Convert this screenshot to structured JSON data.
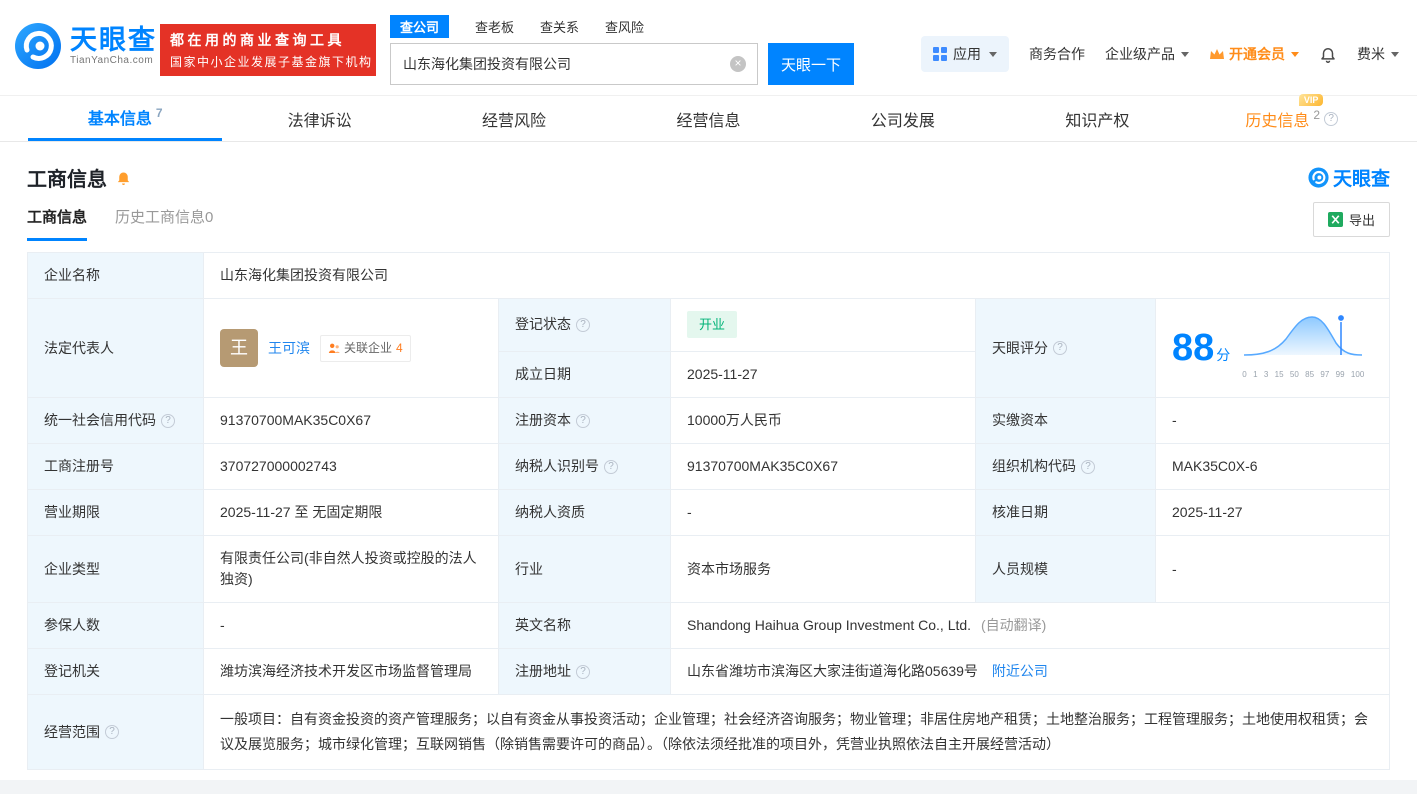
{
  "colors": {
    "accent": "#0084ff",
    "banner_red": "#e43226",
    "vip_orange": "#ff8c19",
    "status_green": "#00b377"
  },
  "header": {
    "logo": {
      "cn": "天眼查",
      "en": "TianYanCha.com"
    },
    "banner": {
      "line1": "都在用的商业查询工具",
      "line2": "国家中小企业发展子基金旗下机构"
    },
    "search": {
      "tabs": [
        {
          "label": "查公司"
        },
        {
          "label": "查老板"
        },
        {
          "label": "查关系"
        },
        {
          "label": "查风险"
        }
      ],
      "value": "山东海化集团投资有限公司",
      "button": "天眼一下"
    },
    "menu": {
      "apps": "应用",
      "cooperation": "商务合作",
      "enterprise": "企业级产品",
      "vip": "开通会员",
      "user": "费米"
    }
  },
  "nav": {
    "tabs": [
      {
        "label": "基本信息",
        "count": "7"
      },
      {
        "label": "法律诉讼"
      },
      {
        "label": "经营风险"
      },
      {
        "label": "经营信息"
      },
      {
        "label": "公司发展"
      },
      {
        "label": "知识产权"
      },
      {
        "label": "历史信息",
        "count": "2",
        "vip_tag": "VIP"
      }
    ]
  },
  "section": {
    "title": "工商信息",
    "watermark": "天眼查",
    "subtabs": [
      {
        "label": "工商信息"
      },
      {
        "label": "历史工商信息",
        "count": "0"
      }
    ],
    "export_label": "导出"
  },
  "table": {
    "company_name_label": "企业名称",
    "company_name": "山东海化集团投资有限公司",
    "legal_rep_label": "法定代表人",
    "legal_rep_avatar": "王",
    "legal_rep_name": "王可滨",
    "related_companies_label": "关联企业",
    "related_companies_count": "4",
    "reg_status_label": "登记状态",
    "reg_status": "开业",
    "est_date_label": "成立日期",
    "est_date": "2025-11-27",
    "score_label": "天眼评分",
    "score": "88",
    "score_unit": "分",
    "score_axis": [
      "0",
      "1",
      "3",
      "15",
      "50",
      "85",
      "97",
      "99",
      "100"
    ],
    "credit_code_label": "统一社会信用代码",
    "credit_code": "91370700MAK35C0X67",
    "reg_capital_label": "注册资本",
    "reg_capital": "10000万人民币",
    "paid_capital_label": "实缴资本",
    "paid_capital": "-",
    "reg_number_label": "工商注册号",
    "reg_number": "370727000002743",
    "taxpayer_id_label": "纳税人识别号",
    "taxpayer_id": "91370700MAK35C0X67",
    "org_code_label": "组织机构代码",
    "org_code": "MAK35C0X-6",
    "business_term_label": "营业期限",
    "business_term": "2025-11-27 至 无固定期限",
    "taxpayer_quality_label": "纳税人资质",
    "taxpayer_quality": "-",
    "approval_date_label": "核准日期",
    "approval_date": "2025-11-27",
    "company_type_label": "企业类型",
    "company_type": "有限责任公司(非自然人投资或控股的法人独资)",
    "industry_label": "行业",
    "industry": "资本市场服务",
    "staff_size_label": "人员规模",
    "staff_size": "-",
    "insured_label": "参保人数",
    "insured": "-",
    "english_name_label": "英文名称",
    "english_name": "Shandong Haihua Group Investment Co., Ltd.",
    "english_name_note": "(自动翻译)",
    "reg_authority_label": "登记机关",
    "reg_authority": "潍坊滨海经济技术开发区市场监督管理局",
    "address_label": "注册地址",
    "address": "山东省潍坊市滨海区大家洼街道海化路05639号",
    "nearby_link": "附近公司",
    "scope_label": "经营范围",
    "scope": "一般项目：自有资金投资的资产管理服务；以自有资金从事投资活动；企业管理；社会经济咨询服务；物业管理；非居住房地产租赁；土地整治服务；工程管理服务；土地使用权租赁；会议及展览服务；城市绿化管理；互联网销售（除销售需要许可的商品）。（除依法须经批准的项目外，凭营业执照依法自主开展经营活动）"
  }
}
